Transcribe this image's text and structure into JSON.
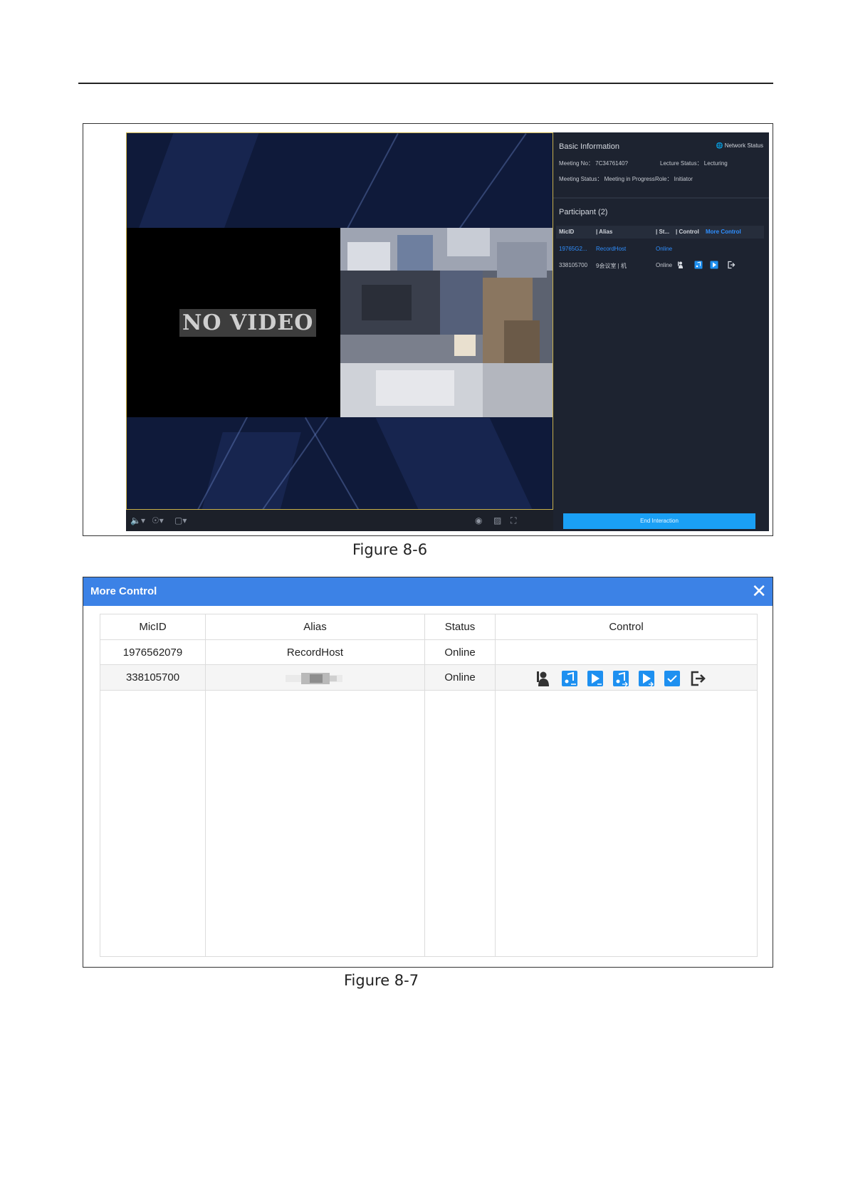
{
  "figure_1": {
    "caption": "Figure 8-6",
    "video": {
      "no_video_label": "NO VIDEO"
    },
    "side_panel": {
      "basic_info_title": "Basic Information",
      "network_status_label": "Network Status",
      "meeting_no": "Meeting No： 7C3476140?",
      "lecture_status": "Lecture Status： Lecturing",
      "meeting_status": "Meeting Status： Meeting in Progress",
      "role": "Role： Initiator",
      "participant_title": "Participant   (2)",
      "header": {
        "micid": "MicID",
        "alias": "| Alias",
        "status": "| St...",
        "control": "| Control",
        "more_control": "More Control"
      },
      "rows": [
        {
          "micid": "19765G2...",
          "alias": "RecordHost",
          "status": "Online"
        },
        {
          "micid": "338105700",
          "alias": "9会议室 | 机",
          "status": "Online"
        }
      ],
      "end_button": "End Interaction"
    }
  },
  "figure_2": {
    "caption": "Figure 8-7",
    "dialog_title": "More Control",
    "close_symbol": "✕",
    "columns": [
      "MicID",
      "Alias",
      "Status",
      "Control"
    ],
    "rows": [
      {
        "micid": "1976562079",
        "alias": "RecordHost",
        "status": "Online"
      },
      {
        "micid": "338105700",
        "alias": "",
        "status": "Online"
      }
    ],
    "control_icons": [
      "speaker-icon",
      "audio-share-icon",
      "video-share-icon",
      "audio-receive-icon",
      "video-receive-icon",
      "confirm-icon",
      "exit-icon"
    ],
    "accent_color": "#3c82e6",
    "icon_color": "#1e90f0"
  }
}
